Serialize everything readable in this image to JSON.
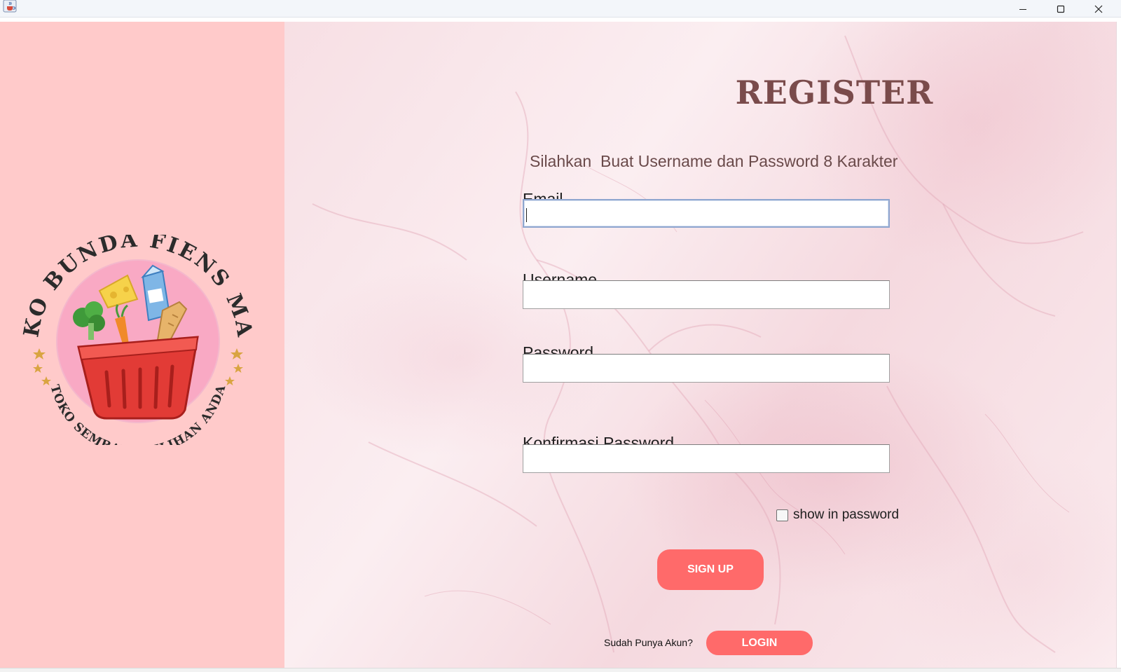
{
  "window": {
    "icon": "java-cup-icon",
    "controls": {
      "minimize": "minimize-icon",
      "maximize": "maximize-icon",
      "close": "close-icon"
    }
  },
  "logo": {
    "top_text": "TOKO BUNDA FIENS MART",
    "bottom_text": "TOKO SEMBAKO PILIHAN ANDA",
    "circle_color": "#f9a9c4",
    "star_color": "#d9a441"
  },
  "form": {
    "title": "REGISTER",
    "subtitle": "Silahkan  Buat Username dan Password 8 Karakter",
    "email_label": "Email",
    "email_value": "",
    "username_label": "Username",
    "username_value": "",
    "password_label": "Password",
    "password_value": "",
    "confirm_label": "Konfirmasi Password",
    "confirm_value": "",
    "show_password_label": "show in password",
    "show_password_checked": false,
    "signup_label": "SIGN UP",
    "have_account_text": "Sudah Punya Akun?",
    "login_label": "LOGIN"
  },
  "colors": {
    "left_panel": "#ffcaca",
    "title": "#7a4b4b",
    "button": "#ff6a6a",
    "focus_border": "#8fa6cf"
  }
}
